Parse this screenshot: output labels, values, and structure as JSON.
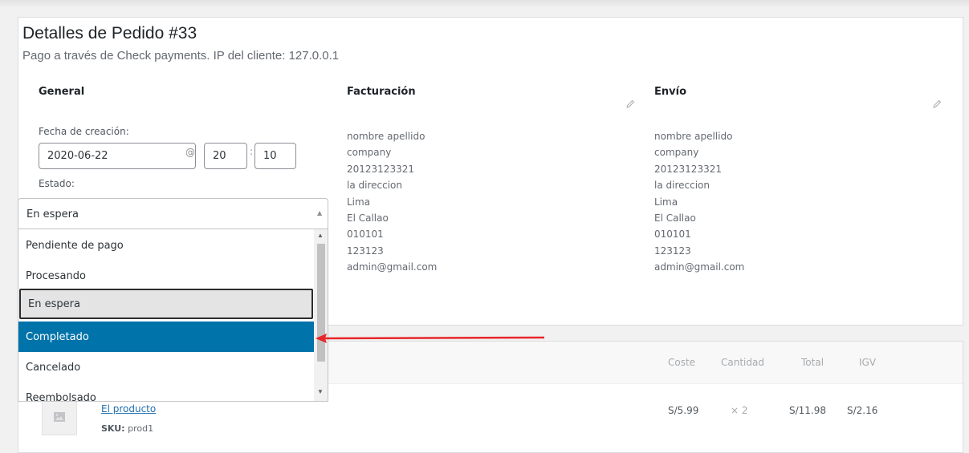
{
  "order": {
    "title": "Detalles de Pedido #33",
    "subtitle": "Pago a través de Check payments. IP del cliente: 127.0.0.1"
  },
  "general": {
    "heading": "General",
    "date_label": "Fecha de creación:",
    "date_value": "2020-06-22",
    "at_symbol": "@",
    "hour_value": "20",
    "colon": ":",
    "minute_value": "10",
    "status_label": "Estado:",
    "status_selected": "En espera",
    "status_options": [
      "Pendiente de pago",
      "Procesando",
      "En espera",
      "Completado",
      "Cancelado",
      "Reembolsado"
    ]
  },
  "billing": {
    "heading": "Facturación",
    "lines": [
      "nombre apellido",
      "company",
      "20123123321",
      "la direccion",
      "Lima",
      "El Callao",
      "010101",
      "123123",
      "admin@gmail.com"
    ]
  },
  "shipping": {
    "heading": "Envío",
    "lines": [
      "nombre apellido",
      "company",
      "20123123321",
      "la direccion",
      "Lima",
      "El Callao",
      "010101",
      "123123",
      "admin@gmail.com"
    ]
  },
  "items": {
    "headers": {
      "cost": "Coste",
      "qty": "Cantidad",
      "total": "Total",
      "tax": "IGV"
    },
    "row": {
      "name": "El producto",
      "sku_label": "SKU:",
      "sku_value": "prod1",
      "cost": "S/5.99",
      "qty": "× 2",
      "total": "S/11.98",
      "tax": "S/2.16"
    }
  },
  "colors": {
    "highlight": "#0073aa",
    "link": "#2271b1",
    "annotation_arrow": "#e8262a"
  },
  "icons": {
    "edit": "pencil-icon",
    "placeholder": "image-placeholder-icon"
  }
}
